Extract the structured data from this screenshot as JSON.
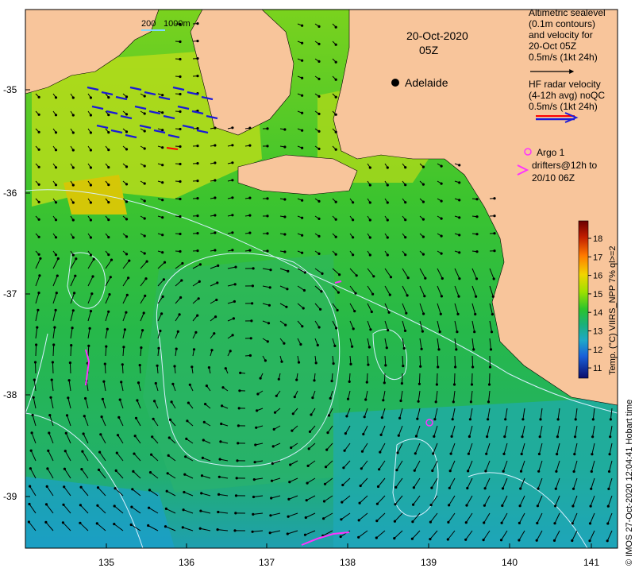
{
  "map": {
    "date_title": "20-Oct-2020",
    "time_title": "05Z",
    "city_label": "Adelaide",
    "scale_label": "200",
    "depth_label": "1000m"
  },
  "legend": {
    "altimetry_lines": [
      "Altimetric sealevel",
      "(0.1m contours)",
      "and velocity for",
      "20-Oct 05Z",
      "0.5m/s (1kt 24h)"
    ],
    "radar_lines": [
      "HF radar velocity",
      "(4-12h avg) noQC",
      "0.5m/s (1kt 24h)"
    ],
    "argo_label": "Argo 1",
    "drifter_lines": [
      "drifters@12h to",
      "20/10 06Z"
    ]
  },
  "axes": {
    "lon_ticks": [
      "135",
      "136",
      "137",
      "138",
      "139",
      "140",
      "141"
    ],
    "lat_ticks": [
      "-35",
      "-36",
      "-37",
      "-38",
      "-39"
    ]
  },
  "colorbar": {
    "title": "Temp. (°C) VIIRS_NPP 7% ql>=2",
    "ticks": [
      "18",
      "17",
      "16",
      "15",
      "14",
      "13",
      "12",
      "11"
    ],
    "colors": [
      "#6b0000",
      "#b31a00",
      "#e65c00",
      "#ffa600",
      "#d9d900",
      "#8fd900",
      "#2bc42b",
      "#17b06b",
      "#1fb0b0",
      "#1f8fd9",
      "#1a5ad9",
      "#1a1ab3",
      "#0b0b6b"
    ]
  },
  "credit": "© IMOS 27-Oct-2020 12:04:41  Hobart time",
  "colors": {
    "land": "#f8c59b",
    "ocean_base": "#2dbd45",
    "contour": "#d8f0ff",
    "radar": "#1a1ad9",
    "drifter": "#ff33ff"
  }
}
